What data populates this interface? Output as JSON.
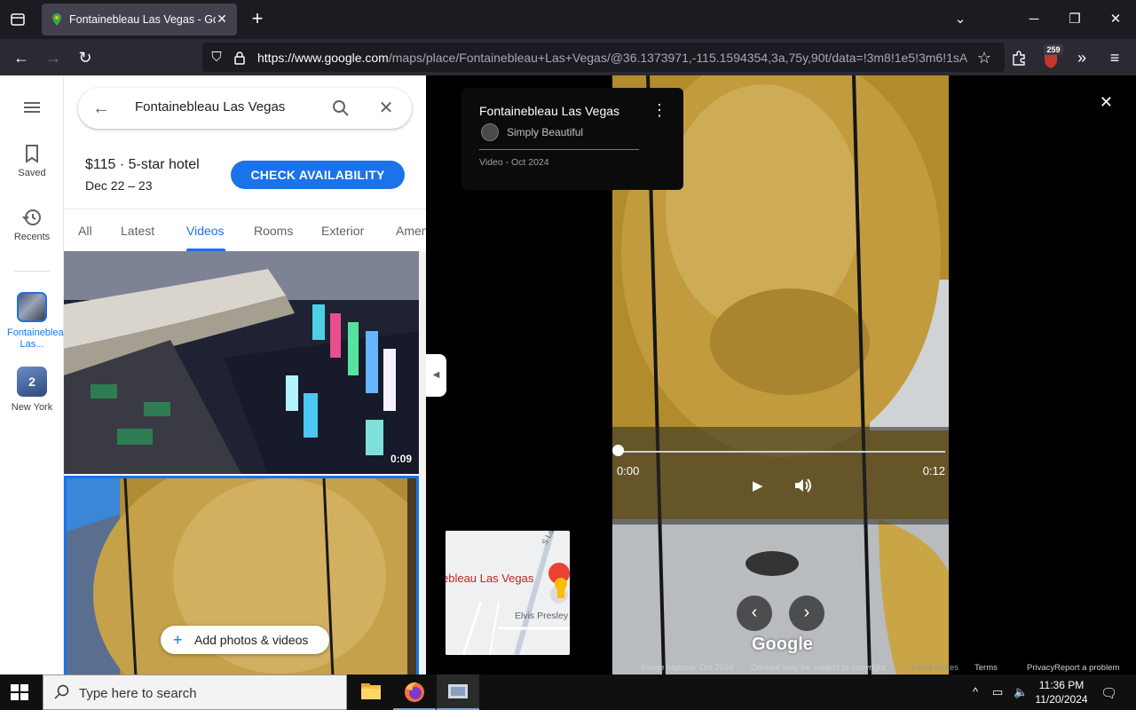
{
  "browser": {
    "tab_title": "Fontainebleau Las Vegas - Goog",
    "url_host": "https://www.google.com",
    "url_path": "/maps/place/Fontainebleau+Las+Vegas/@36.1373971,-115.1594354,3a,75y,90t/data=!3m8!1e5!3m6!1sA",
    "extension_badge": "259"
  },
  "rail": {
    "menu_icon": "menu-icon",
    "saved_label": "Saved",
    "recents_label": "Recents",
    "recent1_label": "Fontainebleau Las...",
    "recent2_label": "New York",
    "recent2_count": "2"
  },
  "search": {
    "query": "Fontainebleau Las Vegas"
  },
  "hotel": {
    "price": "$115 · 5-star hotel",
    "dates": "Dec 22 – 23",
    "cta": "CHECK AVAILABILITY"
  },
  "media_tabs": [
    "All",
    "Latest",
    "Videos",
    "Rooms",
    "Exterior",
    "Amen"
  ],
  "media": {
    "thumb1_duration": "0:09",
    "add_label": "Add photos & videos"
  },
  "viewer": {
    "title": "Fontainebleau Las Vegas",
    "author": "Simply Beautiful",
    "date": "Video - Oct 2024",
    "time_current": "0:00",
    "time_total": "0:12",
    "progress": 0,
    "logo": "Google",
    "minimap_place": "ebleau Las Vegas",
    "minimap_road": "Elvis Presley",
    "minimap_road2": "S La",
    "footer": {
      "capture": "Image capture: Oct 2024",
      "copyright": "Content may be subject to copyright.",
      "country": "United States",
      "terms": "Terms",
      "privacy": "Privacy",
      "report": "Report a problem"
    }
  },
  "taskbar": {
    "search_placeholder": "Type here to search",
    "time": "11:36 PM",
    "date": "11/20/2024"
  }
}
